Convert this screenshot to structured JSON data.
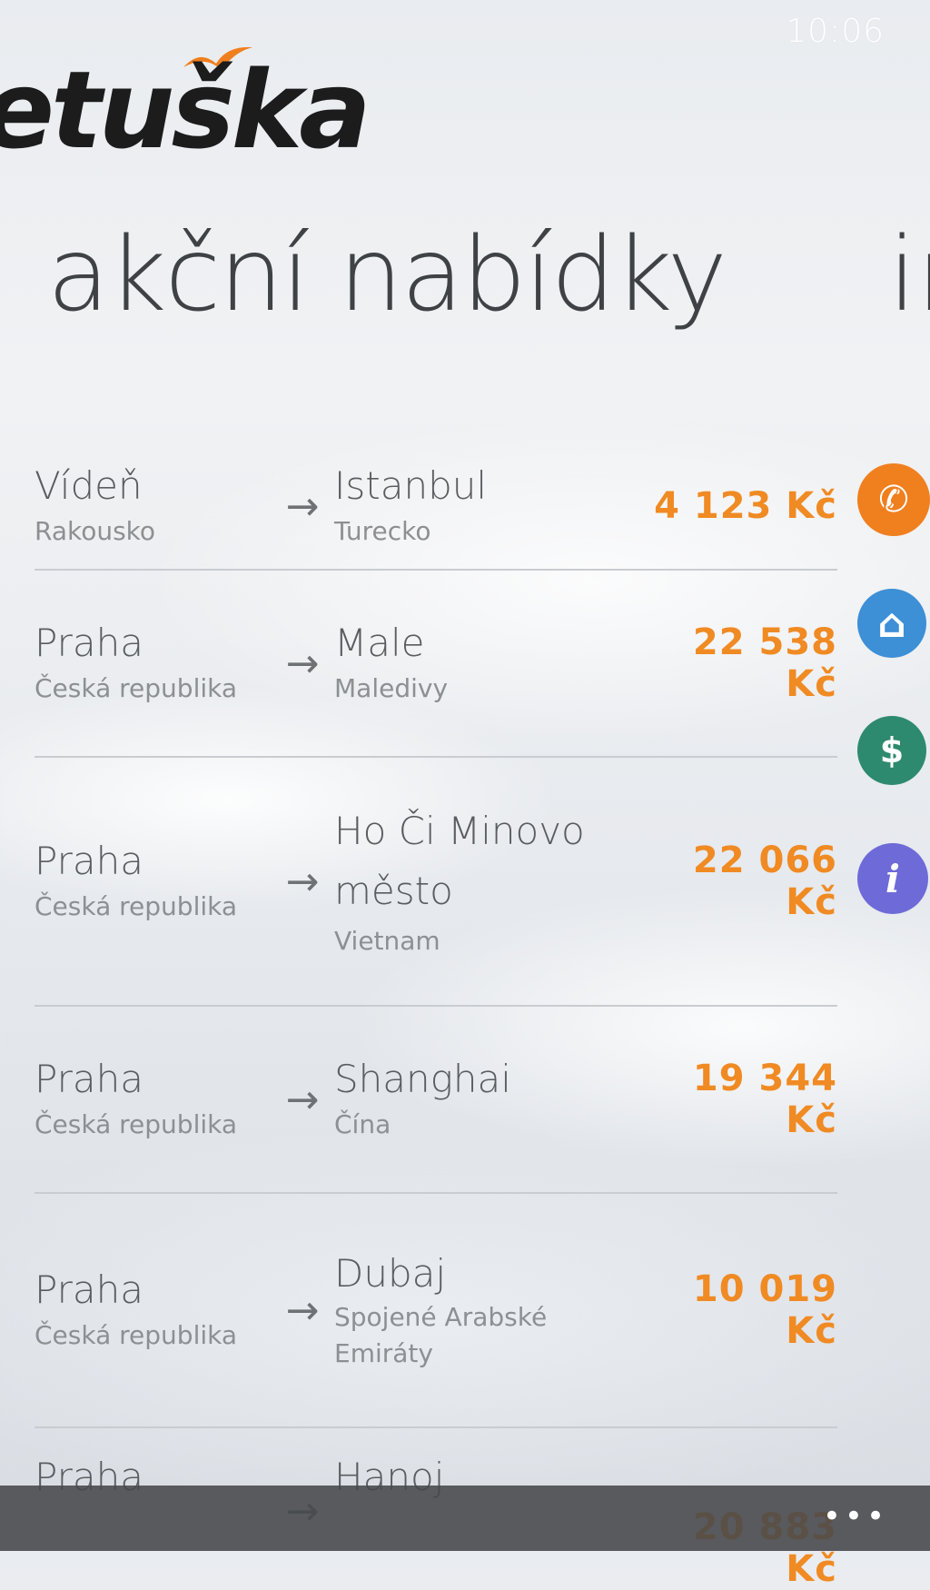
{
  "status": {
    "time": "10:06"
  },
  "app": {
    "logo_text": "etuška",
    "title": "akční nabídky",
    "next_pivot": "ir"
  },
  "deals": [
    {
      "from_city": "Vídeň",
      "from_country": "Rakousko",
      "to_city": "Istanbul",
      "to_country": "Turecko",
      "price": "4 123 Kč"
    },
    {
      "from_city": "Praha",
      "from_country": "Česká republika",
      "to_city": "Male",
      "to_country": "Maledivy",
      "price": "22 538 Kč"
    },
    {
      "from_city": "Praha",
      "from_country": "Česká republika",
      "to_city": "Ho Či Minovo město",
      "to_country": "Vietnam",
      "price": "22 066 Kč"
    },
    {
      "from_city": "Praha",
      "from_country": "Česká republika",
      "to_city": "Shanghai",
      "to_country": "Čína",
      "price": "19 344 Kč"
    },
    {
      "from_city": "Praha",
      "from_country": "Česká republika",
      "to_city": "Dubaj",
      "to_country": "Spojené Arabské Emiráty",
      "price": "10 019 Kč"
    },
    {
      "from_city": "Praha",
      "from_country": "",
      "to_city": "Hanoj",
      "to_country": "",
      "price": "20 883 Kč"
    }
  ],
  "arrow_glyph": "→",
  "side_icons": [
    {
      "icon": "phone-icon",
      "color": "#f07f1e",
      "glyph": "✆"
    },
    {
      "icon": "home-icon",
      "color": "#3d8fd6",
      "glyph": "⌂"
    },
    {
      "icon": "dollar-icon",
      "color": "#2e8a6e",
      "glyph": "$"
    },
    {
      "icon": "info-icon",
      "color": "#6e6ad8",
      "glyph": "i"
    }
  ],
  "appbar": {
    "more": "•••"
  },
  "colors": {
    "accent": "#f08a23",
    "text": "#3f4245"
  }
}
